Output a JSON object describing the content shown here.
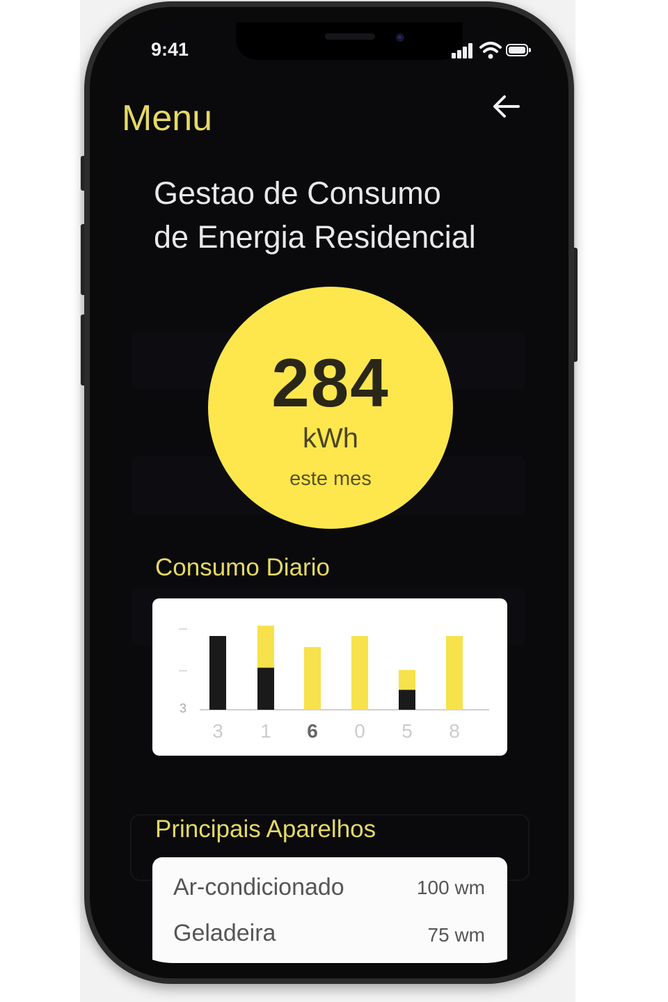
{
  "status_bar": {
    "time": "9:41"
  },
  "header": {
    "title": "Menu",
    "back_icon": "arrow-left-icon"
  },
  "app": {
    "title_line1": "Gestao de Consumo",
    "title_line2": "de Energia Residencial"
  },
  "consumption": {
    "value": "284",
    "unit": "kWh",
    "period": "este mes"
  },
  "daily": {
    "title": "Consumo Diario"
  },
  "chart_data": {
    "type": "bar",
    "categories": [
      "3",
      "1",
      "6",
      "0",
      "5",
      "8"
    ],
    "series": [
      {
        "values": [
          1.0,
          0.57,
          0.0,
          0.0,
          0.27,
          0.0
        ]
      },
      {
        "values": [
          0.0,
          0.57,
          0.85,
          1.0,
          0.27,
          1.0
        ]
      }
    ],
    "ylabel_tick": "3",
    "colors": [
      "#f7e24b",
      "#1a1a1a"
    ],
    "highlighted_category": "6"
  },
  "appliances": {
    "title": "Principais Aparelhos",
    "items": [
      {
        "name": "Ar-condicionado",
        "value": "100 wm"
      },
      {
        "name": "Geladeira",
        "value": "75 wm"
      }
    ]
  },
  "colors": {
    "accent": "#e5d964",
    "circle": "#fde74c",
    "background": "#0a0a0d"
  }
}
